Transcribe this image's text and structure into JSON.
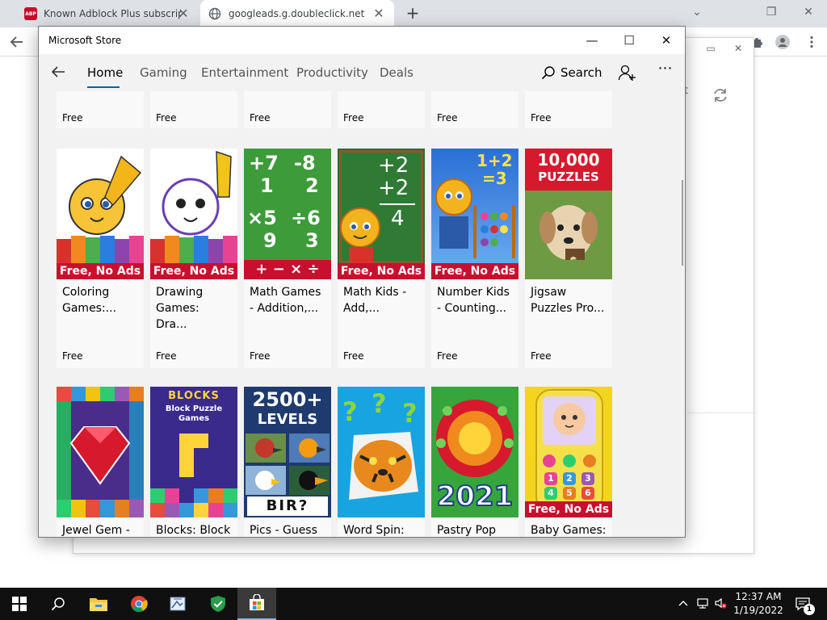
{
  "browser": {
    "tabs": [
      {
        "title": "Known Adblock Plus subscriptior",
        "close": "✕"
      },
      {
        "title": "googleads.g.doubleclick.net",
        "close": "✕"
      }
    ],
    "new_tab": "+",
    "abp_text": "ABP",
    "window_controls": {
      "chevron": "⌄",
      "restore": "❐",
      "close": "✕"
    },
    "panel_controls": {
      "restore": "▭",
      "close": "✕"
    },
    "panel_partial_text": "t"
  },
  "store": {
    "window_title": "Microsoft Store",
    "window_controls": {
      "minimize": "—",
      "maximize": "☐",
      "close": "✕"
    },
    "nav": {
      "tabs": [
        "Home",
        "Gaming",
        "Entertainment",
        "Productivity",
        "Deals"
      ],
      "search_label": "Search",
      "more": "⋯"
    },
    "top_row_prices": [
      "Free",
      "Free",
      "Free",
      "Free",
      "Free",
      "Free"
    ],
    "apps_row1": [
      {
        "name": "Coloring\nGames:...",
        "price": "Free",
        "badge": "Free, No Ads"
      },
      {
        "name": "Drawing\nGames: Dra...",
        "price": "Free",
        "badge": "Free, No Ads"
      },
      {
        "name": "Math Games\n- Addition,...",
        "price": "Free",
        "badge": ""
      },
      {
        "name": "Math Kids -\nAdd,...",
        "price": "Free",
        "badge": "Free, No Ads"
      },
      {
        "name": "Number Kids\n- Counting...",
        "price": "Free",
        "badge": "Free, No Ads"
      },
      {
        "name": "Jigsaw\nPuzzles Pro...",
        "price": "Free",
        "badge": ""
      }
    ],
    "apps_row2": [
      {
        "name": "Jewel Gem -"
      },
      {
        "name": "Blocks: Block"
      },
      {
        "name": "Pics - Guess"
      },
      {
        "name": "Word Spin:"
      },
      {
        "name": "Pastry Pop"
      },
      {
        "name": "Baby Games:",
        "badge": "Free, No Ads"
      }
    ],
    "art_text": {
      "math_ops": [
        "+7",
        "-8",
        "1",
        "2",
        "×5",
        "÷6",
        "9",
        "3",
        "+ − × ÷"
      ],
      "math_kids": [
        "+2",
        "+2",
        "4"
      ],
      "number_kids": "1+2\n=3",
      "jigsaw": [
        "10,000",
        "PUZZLES"
      ],
      "blocks": [
        "BLOCKS",
        "Block Puzzle",
        "Games"
      ],
      "pics": [
        "2500+",
        "LEVELS",
        "BIR?"
      ],
      "pastry_year": "2021",
      "baby_phone_keys": [
        "1",
        "2",
        "3",
        "4",
        "5",
        "6"
      ]
    }
  },
  "taskbar": {
    "time": "12:37 AM",
    "date": "1/19/2022",
    "notification_count": "1"
  }
}
